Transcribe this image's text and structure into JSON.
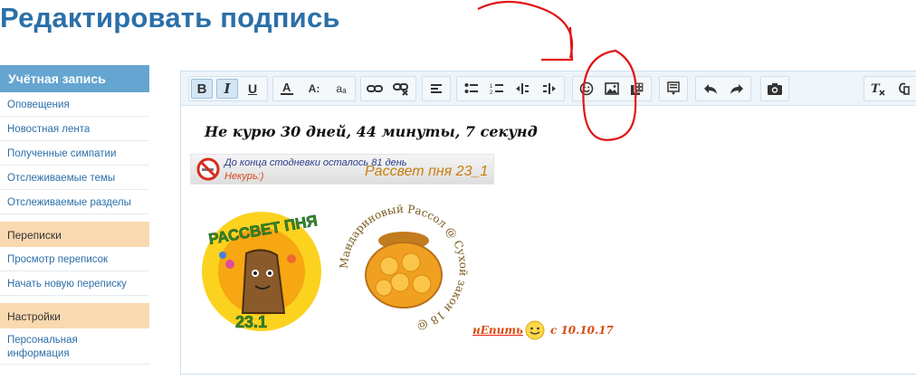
{
  "page": {
    "title": "Редактировать подпись"
  },
  "sidebar": {
    "account_header": "Учётная запись",
    "account_items": [
      {
        "label": "Оповещения"
      },
      {
        "label": "Новостная лента"
      },
      {
        "label": "Полученные симпатии"
      },
      {
        "label": "Отслеживаемые темы"
      },
      {
        "label": "Отслеживаемые разделы"
      }
    ],
    "messages_header": "Переписки",
    "messages_items": [
      {
        "label": "Просмотр переписок"
      },
      {
        "label": "Начать новую переписку"
      }
    ],
    "settings_header": "Настройки",
    "settings_items": [
      {
        "label": "Персональная информация"
      }
    ]
  },
  "toolbar": {
    "bold": "B",
    "italic": "I",
    "underline": "U",
    "text_size": "A:",
    "font_case": "aₐ"
  },
  "signature": {
    "line1": "Не курю  30 дней, 44 минуты, 7 секунд",
    "banner_line1": "До конца стодневки осталось 81 день",
    "banner_line2": "Некурь:)",
    "banner_right": "Рассвет пня 23_1",
    "logo1_title": "РАССВЕТ ПНЯ",
    "logo1_number": "23.1",
    "logo2_ring": "Мандариновый Рассол @ Сухой закон 18 @",
    "last_a": "нЕпить",
    "last_b": "с 10.10.17"
  },
  "colors": {
    "title": "#2b6fa8",
    "sidebar_header": "#65a5d1",
    "sidebar_group": "#f9d9b0",
    "annotation": "#e01515"
  }
}
